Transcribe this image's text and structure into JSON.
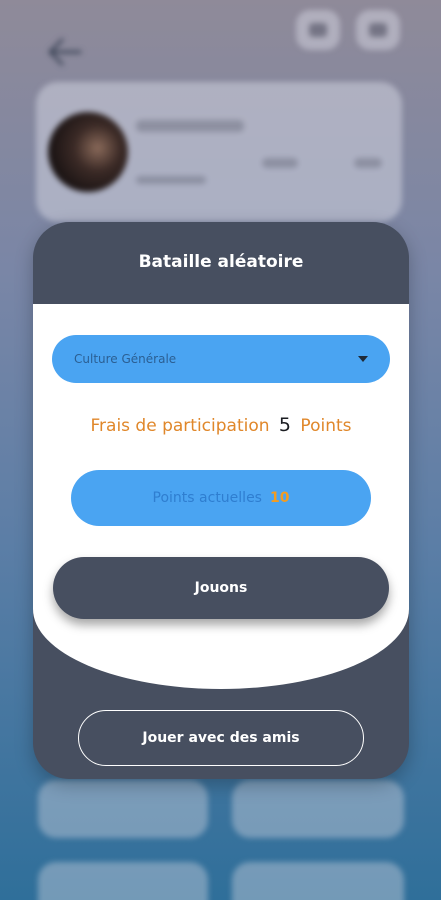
{
  "modal": {
    "title": "Bataille aléatoire",
    "category_select": {
      "value": "Culture Générale"
    },
    "fee": {
      "label": "Frais de participation",
      "amount": "5",
      "unit": "Points"
    },
    "current_points": {
      "label": "Points actuelles",
      "value": "10"
    },
    "play_label": "Jouons",
    "friends_label": "Jouer avec des amis"
  },
  "colors": {
    "modal_bg": "#474f60",
    "accent_blue": "#4aa4f2",
    "fee_orange": "#e0872a",
    "points_orange": "#f39c21"
  },
  "icons": {
    "back": "arrow-left-icon",
    "caret": "caret-down-icon"
  }
}
